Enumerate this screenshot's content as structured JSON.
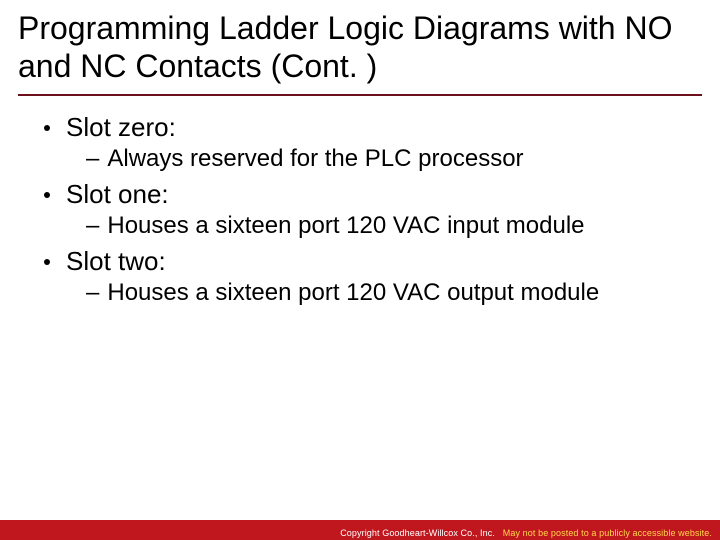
{
  "title": "Programming Ladder Logic Diagrams with NO and NC Contacts (Cont. )",
  "bullets": [
    {
      "level": 1,
      "text": "Slot zero:"
    },
    {
      "level": 2,
      "text": "Always reserved for the PLC processor"
    },
    {
      "level": 1,
      "text": "Slot one:"
    },
    {
      "level": 2,
      "text": "Houses a sixteen port 120 VAC input module"
    },
    {
      "level": 1,
      "text": "Slot two:"
    },
    {
      "level": 2,
      "text": "Houses a sixteen port 120 VAC output module"
    }
  ],
  "footer": {
    "copyright": "Copyright Goodheart-Willcox Co., Inc.",
    "warning": "May not be posted to a publicly accessible website."
  }
}
